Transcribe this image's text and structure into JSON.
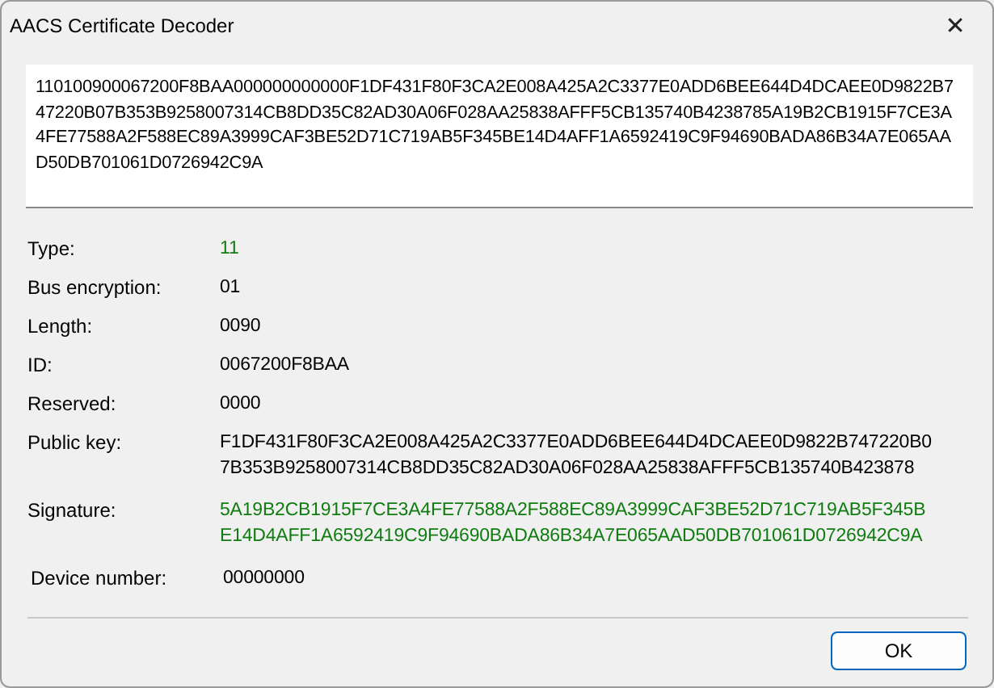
{
  "window": {
    "title": "AACS Certificate Decoder",
    "close": "✕"
  },
  "certificate_text": {
    "lines": [
      "110100900067200F8BAA000000000000F1DF431F80F3CA2E008A425A2C3377E0ADD6BEE644D4DCAEE0D9822B7",
      "47220B07B353B9258007314CB8DD35C82AD30A06F028AA25838AFFF5CB135740B4238785A19B2CB1915F7CE3A",
      "4FE77588A2F588EC89A3999CAF3BE52D71C719AB5F345BE14D4AFF1A6592419C9F94690BADA86B34A7E065AA",
      "D50DB701061D0726942C9A"
    ]
  },
  "fields": [
    {
      "label": "Type:",
      "value": [
        "11"
      ],
      "color": "#107c10"
    },
    {
      "label": "Bus encryption:",
      "value": [
        "01"
      ],
      "color": "#000000"
    },
    {
      "label": "Length:",
      "value": [
        "0090"
      ],
      "color": "#000000"
    },
    {
      "label": "ID:",
      "value": [
        "0067200F8BAA"
      ],
      "color": "#000000"
    },
    {
      "label": "Reserved:",
      "value": [
        "0000"
      ],
      "color": "#000000"
    },
    {
      "label": "Public key:",
      "value": [
        "F1DF431F80F3CA2E008A425A2C3377E0ADD6BEE644D4DCAEE0D9822B747220B0",
        "7B353B9258007314CB8DD35C82AD30A06F028AA25838AFFF5CB135740B423878"
      ],
      "color": "#000000"
    },
    {
      "label": "Signature:",
      "value": [
        "5A19B2CB1915F7CE3A4FE77588A2F588EC89A3999CAF3BE52D71C719AB5F345B",
        "E14D4AFF1A6592419C9F94690BADA86B34A7E065AAD50DB701061D0726942C9A"
      ],
      "color": "#107c10"
    },
    {
      "label": "Device number:",
      "value": [
        "00000000"
      ],
      "color": "#000000"
    }
  ],
  "buttons": [
    "OK"
  ]
}
